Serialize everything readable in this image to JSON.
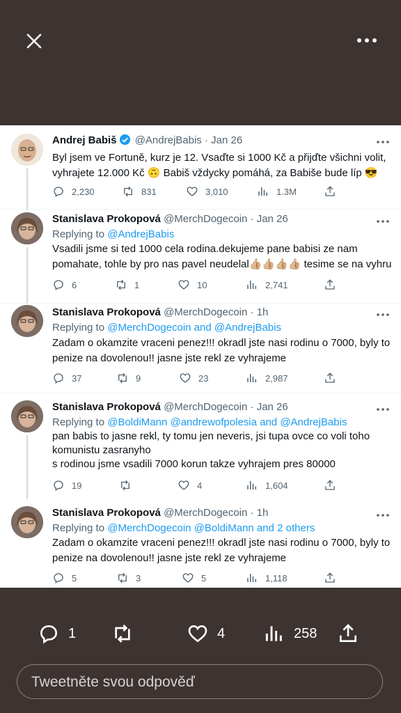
{
  "top": {
    "close_icon": "close-icon",
    "more_icon": "more-icon"
  },
  "tweets": [
    {
      "name": "Andrej Babiš",
      "handle": "@AndrejBabis",
      "time": "· Jan 26",
      "verified": true,
      "replying_prefix": "",
      "replying_to": "",
      "text": "Byl jsem ve Fortuně, kurz je 12. Vsaďte si 1000 Kč a přijďte všichni volit, vyhrajete 12.000 Kč 🙃 Babiš vždycky pomáhá, za Babiše bude líp 😎",
      "replies": "2,230",
      "retweets": "831",
      "likes": "3,010",
      "views": "1.3M"
    },
    {
      "name": "Stanislava Prokopová",
      "handle": "@MerchDogecoin",
      "time": "· Jan 26",
      "replying_prefix": "Replying to",
      "replying_to": "@AndrejBabis",
      "text": "Vsadili jsme si ted 1000 cela rodina.dekujeme pane babisi ze nam pomahate, tohle by pro nas pavel neudelal👍🏼👍🏼👍🏼👍🏼 tesime se na vyhru",
      "replies": "6",
      "retweets": "1",
      "likes": "10",
      "views": "2,741"
    },
    {
      "name": "Stanislava Prokopová",
      "handle": "@MerchDogecoin",
      "time": "· 1h",
      "replying_prefix": "Replying to",
      "replying_to": "@MerchDogecoin and @AndrejBabis",
      "text": "Zadam o okamzite vraceni penez!!! okradl jste nasi rodinu o 7000, byly to penize na dovolenou!! jasne jste rekl ze vyhrajeme",
      "replies": "37",
      "retweets": "9",
      "likes": "23",
      "views": "2,987"
    },
    {
      "name": "Stanislava Prokopová",
      "handle": "@MerchDogecoin",
      "time": "· Jan 26",
      "replying_prefix": "Replying to",
      "replying_to": "@BoldiMann @andrewofpolesia and @AndrejBabis",
      "text": "pan babis to jasne rekl, ty tomu jen neveris, jsi tupa ovce co voli toho komunistu zasranyho",
      "text2": "s rodinou jsme vsadili 7000 korun takze vyhrajem pres 80000",
      "replies": "19",
      "retweets": "",
      "likes": "4",
      "views": "1,604"
    },
    {
      "name": "Stanislava Prokopová",
      "handle": "@MerchDogecoin",
      "time": "· 1h",
      "replying_prefix": "Replying to",
      "replying_to": "@MerchDogecoin @BoldiMann and 2 others",
      "text": "Zadam o okamzite vraceni penez!!! okradl jste nasi rodinu o 7000, byly to penize na dovolenou!! jasne jste rekl ze vyhrajeme",
      "replies": "5",
      "retweets": "3",
      "likes": "5",
      "views": "1,118"
    }
  ],
  "bottom": {
    "replies": "1",
    "likes": "4",
    "views": "258",
    "reply_placeholder": "Tweetněte svou odpověď"
  },
  "colors": {
    "background": "#3d3432",
    "accent": "#1d9bf0",
    "text": "#0f1419",
    "muted": "#536471"
  }
}
